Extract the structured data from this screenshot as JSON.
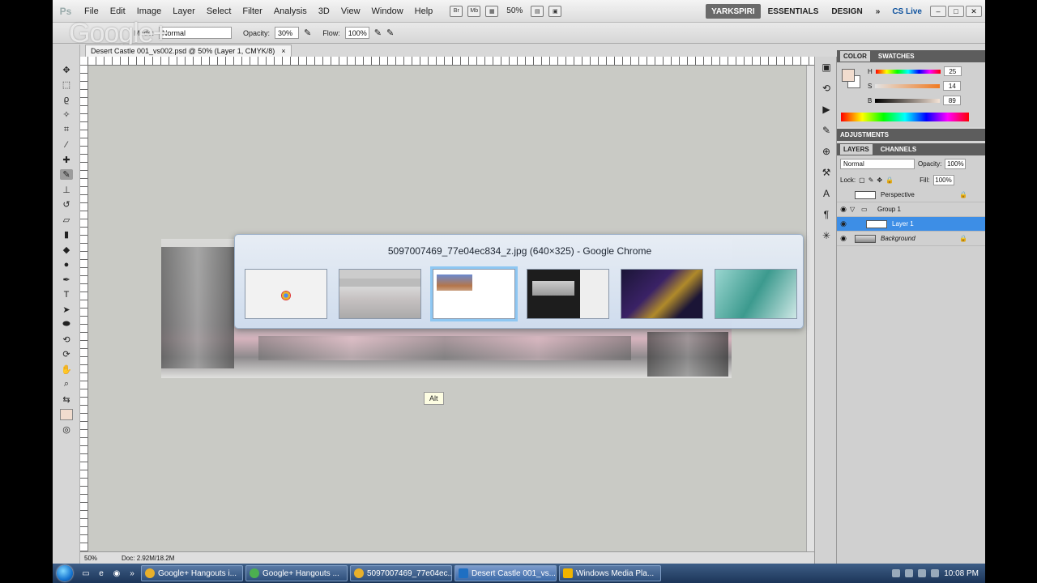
{
  "app": {
    "logo": "Ps"
  },
  "menu": [
    "File",
    "Edit",
    "Image",
    "Layer",
    "Select",
    "Filter",
    "Analysis",
    "3D",
    "View",
    "Window",
    "Help"
  ],
  "menubar": {
    "zoom": "50%"
  },
  "workspace": {
    "active": "YARKSPIRI",
    "items": [
      "ESSENTIALS",
      "DESIGN"
    ],
    "more": "»",
    "cslive": "CS Live"
  },
  "options": {
    "mode_label": "Mode:",
    "mode_value": "Normal",
    "opacity_label": "Opacity:",
    "opacity_value": "30%",
    "flow_label": "Flow:",
    "flow_value": "100%"
  },
  "watermark": "Google+",
  "doc_tab": {
    "title": "Desert Castle 001_vs002.psd @ 50% (Layer 1, CMYK/8)",
    "close": "×"
  },
  "status": {
    "zoom": "50%",
    "doc": "Doc: 2.92M/18.2M"
  },
  "color_panel": {
    "tabs": [
      "COLOR",
      "SWATCHES"
    ],
    "h_label": "H",
    "h": "25",
    "s_label": "S",
    "s": "14",
    "b_label": "B",
    "b": "89"
  },
  "adjustments": {
    "title": "ADJUSTMENTS"
  },
  "layers_panel": {
    "tabs": [
      "LAYERS",
      "CHANNELS"
    ],
    "blend": "Normal",
    "opacity_label": "Opacity:",
    "opacity": "100%",
    "lock_label": "Lock:",
    "fill_label": "Fill:",
    "fill": "100%",
    "layers": [
      {
        "name": "Perspective",
        "visible": false,
        "locked": true,
        "selected": false
      },
      {
        "name": "Group 1",
        "visible": true,
        "locked": false,
        "selected": false
      },
      {
        "name": "Layer 1",
        "visible": true,
        "locked": false,
        "selected": true
      },
      {
        "name": "Background",
        "visible": true,
        "locked": true,
        "selected": false
      }
    ]
  },
  "alt_tab": {
    "title": "5097007469_77e04ec834_z.jpg (640×325) - Google Chrome",
    "windows": [
      "chrome-new-tab",
      "photoshop-sketch",
      "chrome-image",
      "photoshop-dark",
      "media-player",
      "concept-art"
    ],
    "selected_index": 2
  },
  "alt_badge": "Alt",
  "taskbar": {
    "buttons": [
      {
        "label": "Google+ Hangouts i...",
        "icon": "chrome-icon",
        "color": "#e8b02b"
      },
      {
        "label": "Google+ Hangouts ...",
        "icon": "hangouts-icon",
        "color": "#4caf50"
      },
      {
        "label": "5097007469_77e04ec...",
        "icon": "chrome-icon",
        "color": "#e8b02b"
      },
      {
        "label": "Desert Castle 001_vs...",
        "icon": "photoshop-icon",
        "color": "#1f6fc2"
      },
      {
        "label": "Windows Media Pla...",
        "icon": "media-player-icon",
        "color": "#f0b400"
      }
    ],
    "active_index": 3,
    "clock": "10:08 PM"
  }
}
